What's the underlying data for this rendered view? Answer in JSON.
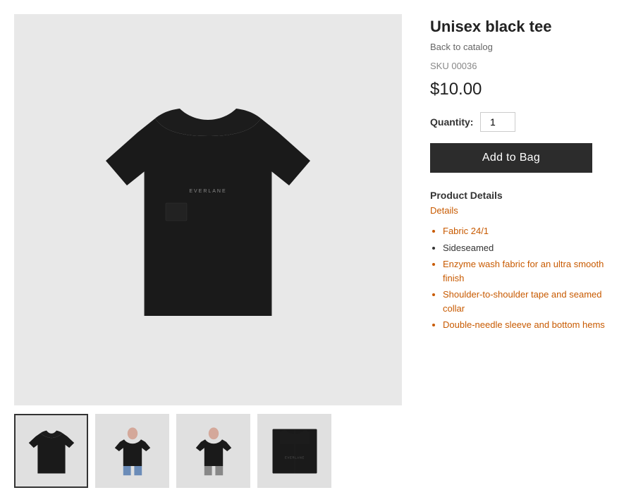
{
  "product": {
    "title": "Unisex black tee",
    "back_to_catalog": "Back to catalog",
    "sku_label": "SKU 00036",
    "price": "$10.00",
    "quantity_label": "Quantity:",
    "quantity_value": "1",
    "add_to_bag_label": "Add to Bag",
    "product_details_header": "Product Details",
    "details_link": "Details",
    "details_list": [
      {
        "text": "Fabric 24/1",
        "highlight": true
      },
      {
        "text": "Sideseamed",
        "highlight": false
      },
      {
        "text": "Enzyme wash fabric for an ultra smooth finish",
        "highlight": true
      },
      {
        "text": "Shoulder-to-shoulder tape and seamed collar",
        "highlight": true
      },
      {
        "text": "Double-needle sleeve and bottom hems",
        "highlight": true
      }
    ]
  },
  "thumbnails": [
    {
      "label": "thumb-1-flat",
      "active": true
    },
    {
      "label": "thumb-2-woman-front",
      "active": false
    },
    {
      "label": "thumb-3-man-back",
      "active": false
    },
    {
      "label": "thumb-4-man-back-close",
      "active": false
    }
  ],
  "colors": {
    "bg_main": "#e8e8e8",
    "tshirt_color": "#1a1a1a",
    "button_bg": "#2c2c2c",
    "orange": "#c85a00",
    "thumbnail_border_active": "#333"
  }
}
